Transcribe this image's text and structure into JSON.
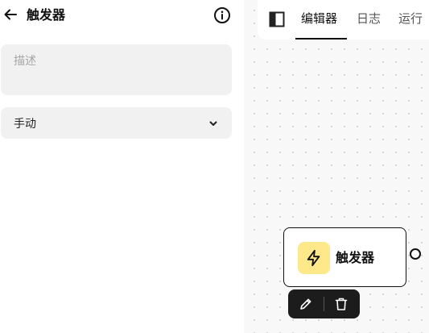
{
  "panel": {
    "title": "触发器",
    "description_placeholder": "描述",
    "description_value": "",
    "mode_selected": "手动"
  },
  "toolbar": {
    "tabs": [
      {
        "label": "编辑器",
        "active": true
      },
      {
        "label": "日志",
        "active": false
      },
      {
        "label": "运行",
        "active": false
      }
    ]
  },
  "node": {
    "label": "触发器",
    "icon": "lightning-icon",
    "icon_bg": "#fde98a"
  },
  "icons": {
    "back": "arrow-left-icon",
    "info": "info-icon",
    "chevron": "chevron-down-icon",
    "sidebar_toggle": "sidebar-toggle-icon",
    "edit": "pencil-icon",
    "delete": "trash-icon"
  }
}
